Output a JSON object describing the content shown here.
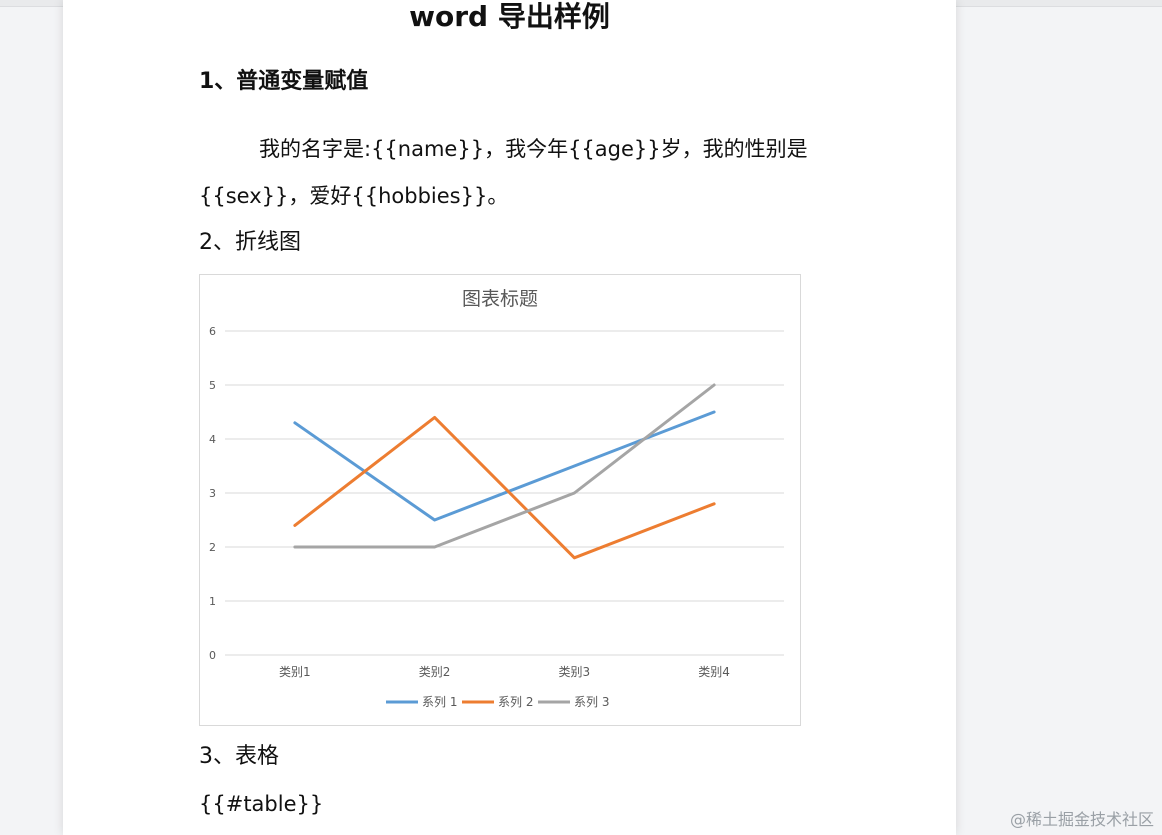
{
  "document": {
    "title": "word 导出样例",
    "section1_heading": "1、普通变量赋值",
    "para1_line1": "我的名字是:{{name}}，我今年{{age}}岁，我的性别是",
    "para1_line2": "{{sex}}，爱好{{hobbies}}。",
    "section2_heading": "2、折线图",
    "section3_heading": "3、表格",
    "table_placeholder": "{{#table}}"
  },
  "watermark": "@稀土掘金技术社区",
  "chart_data": {
    "type": "line",
    "title": "图表标题",
    "categories": [
      "类别1",
      "类别2",
      "类别3",
      "类别4"
    ],
    "series": [
      {
        "name": "系列 1",
        "values": [
          4.3,
          2.5,
          3.5,
          4.5
        ],
        "color": "#5b9bd5"
      },
      {
        "name": "系列 2",
        "values": [
          2.4,
          4.4,
          1.8,
          2.8
        ],
        "color": "#ed7d31"
      },
      {
        "name": "系列 3",
        "values": [
          2,
          2,
          3,
          5
        ],
        "color": "#a5a5a5"
      }
    ],
    "ylim": [
      0,
      6
    ],
    "yticks": [
      0,
      1,
      2,
      3,
      4,
      5,
      6
    ],
    "grid": true,
    "legend": "bottom"
  }
}
